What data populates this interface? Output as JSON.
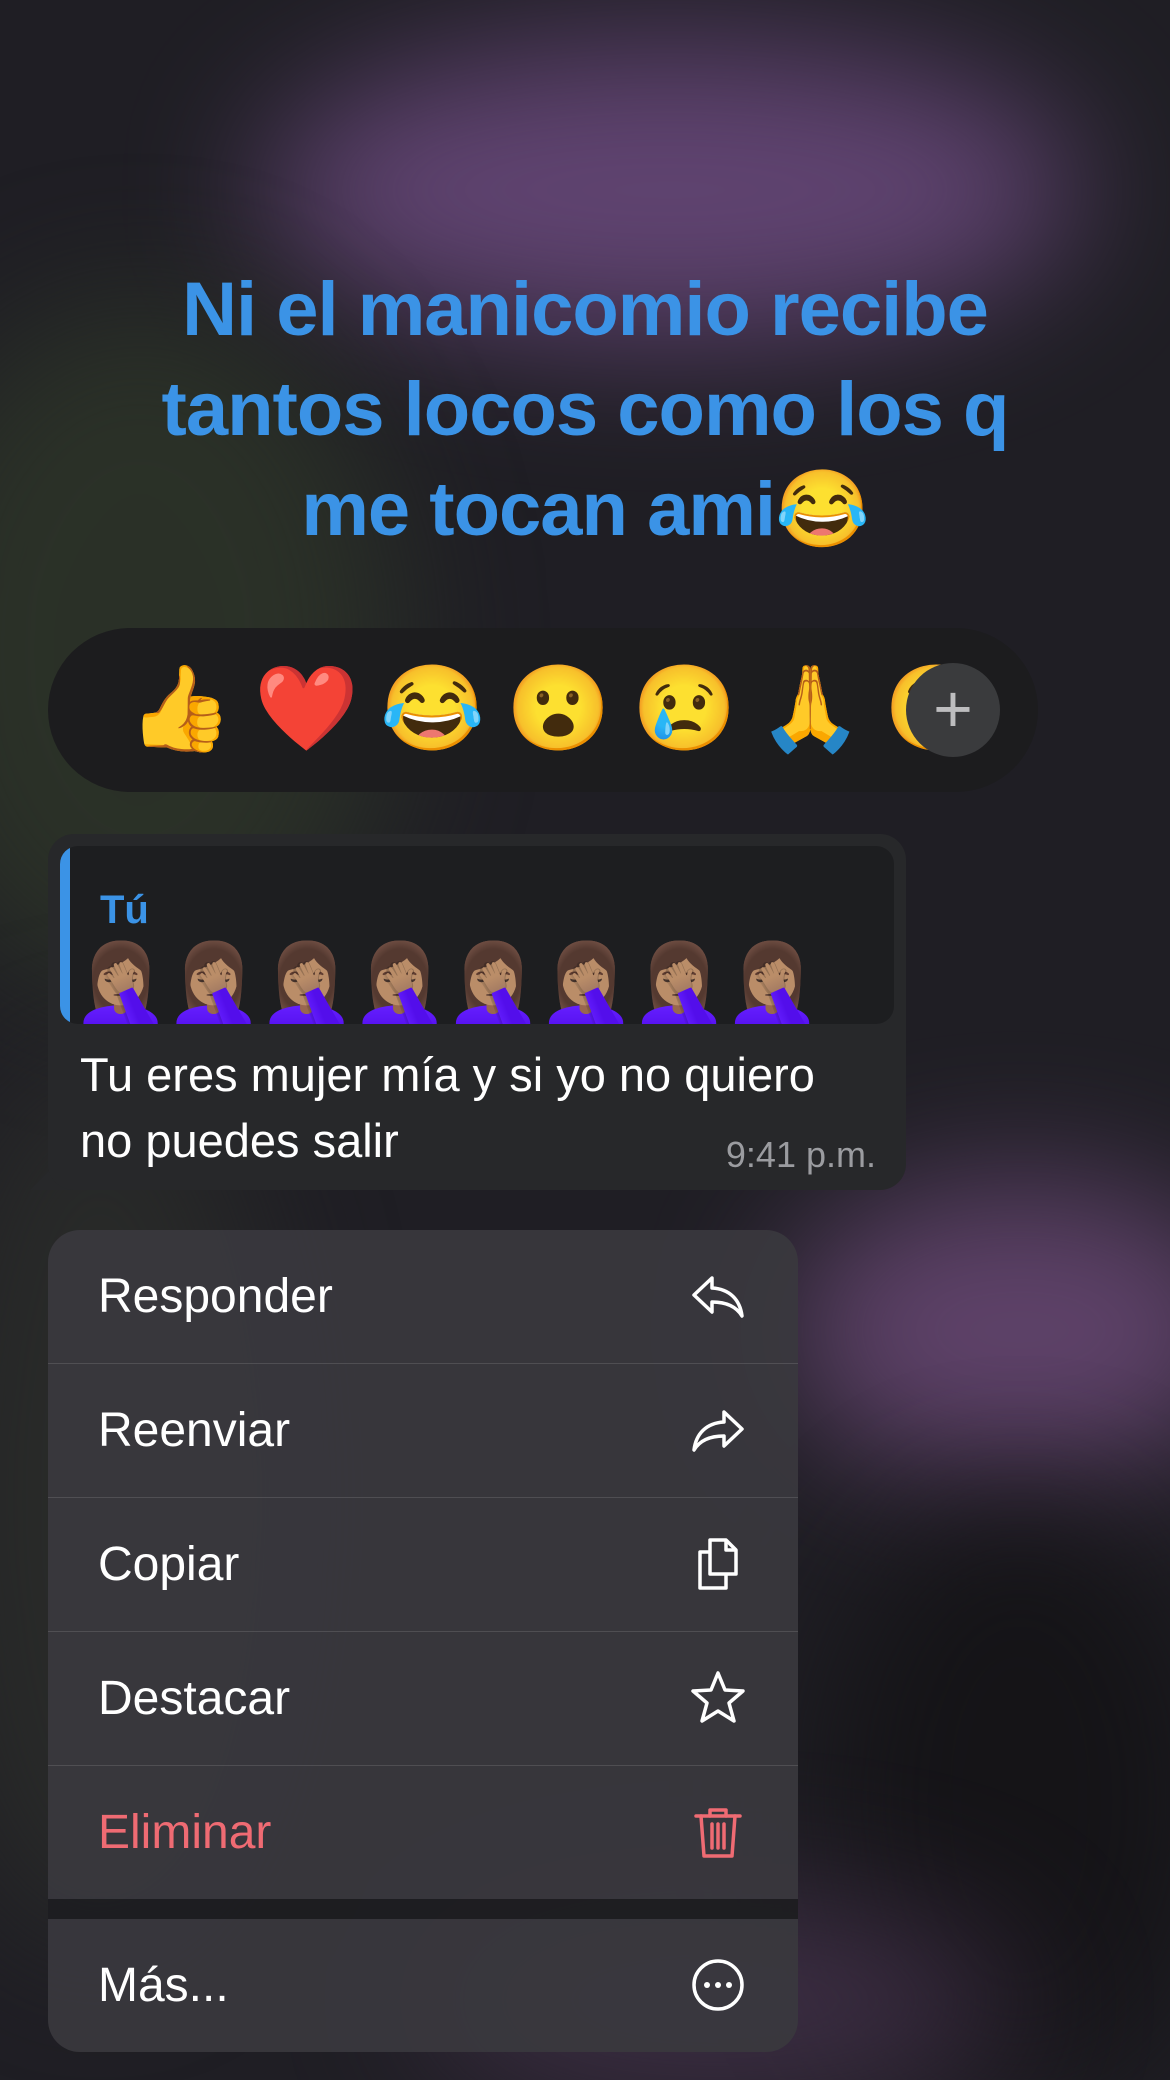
{
  "caption": {
    "line1": "Ni el manicomio recibe",
    "line2": "tantos locos como los q",
    "line3": "me tocan ami😂"
  },
  "reactions": {
    "emojis": [
      "👍",
      "❤️",
      "😂",
      "😮",
      "😢",
      "🙏",
      "😉"
    ],
    "add_label": "+"
  },
  "message": {
    "quote_author": "Tú",
    "quote_content": "🤦🏽‍♀️🤦🏽‍♀️🤦🏽‍♀️🤦🏽‍♀️🤦🏽‍♀️🤦🏽‍♀️🤦🏽‍♀️🤦🏽‍♀️",
    "text": "Tu eres mujer mía y si yo no quiero no puedes salir",
    "time": "9:41 p.m."
  },
  "menu": {
    "items": [
      {
        "label": "Responder",
        "icon": "reply-icon"
      },
      {
        "label": "Reenviar",
        "icon": "forward-icon"
      },
      {
        "label": "Copiar",
        "icon": "copy-icon"
      },
      {
        "label": "Destacar",
        "icon": "star-icon"
      },
      {
        "label": "Eliminar",
        "icon": "trash-icon",
        "color": "#ef6b73"
      }
    ],
    "more": {
      "label": "Más...",
      "icon": "ellipsis-icon"
    }
  },
  "colors": {
    "accent": "#3b93e6",
    "danger": "#ef6b73"
  }
}
